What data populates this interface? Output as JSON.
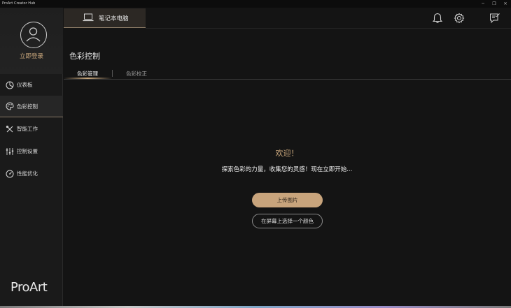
{
  "window": {
    "title": "ProArt Creator Hub",
    "controls": {
      "minimize": "─",
      "maximize": "❐",
      "close": "✕"
    }
  },
  "sidebar": {
    "login_label": "立即登录",
    "items": [
      {
        "label": "仪表板",
        "icon": "dashboard-icon"
      },
      {
        "label": "色彩控制",
        "icon": "palette-icon",
        "active": true
      },
      {
        "label": "智能工作",
        "icon": "tools-icon"
      },
      {
        "label": "控制设置",
        "icon": "sliders-icon"
      },
      {
        "label": "性能优化",
        "icon": "performance-icon"
      }
    ],
    "logo": "ProArt"
  },
  "header": {
    "device_tab": "笔记本电脑",
    "icons": [
      "bell-icon",
      "gear-icon",
      "feedback-icon"
    ]
  },
  "main": {
    "title": "色彩控制",
    "tabs": [
      {
        "label": "色彩管理",
        "active": true
      },
      {
        "label": "色彩校正",
        "active": false
      }
    ],
    "welcome": "欢迎！",
    "description": "探索色彩的力量，收集您的灵感！现在立即开始...",
    "primary_button": "上传图片",
    "secondary_button": "在屏幕上选择一个颜色"
  },
  "colors": {
    "accent": "#c8a47c",
    "background": "#141414",
    "sidebar": "#1a1a1a"
  }
}
